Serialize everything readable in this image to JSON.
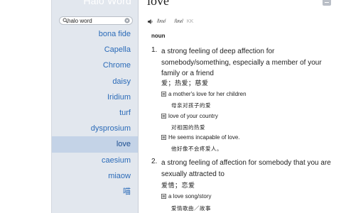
{
  "app": {
    "title": "Halo Word"
  },
  "search": {
    "value": "halo word",
    "placeholder": ""
  },
  "word_list": [
    {
      "label": "bona fide"
    },
    {
      "label": "Capella"
    },
    {
      "label": "Chrome"
    },
    {
      "label": "daisy"
    },
    {
      "label": "Iridium"
    },
    {
      "label": "turf"
    },
    {
      "label": "dysprosium"
    },
    {
      "label": "love",
      "selected": true
    },
    {
      "label": "caesium"
    },
    {
      "label": "miaow"
    },
    {
      "label": "喵"
    }
  ],
  "entry": {
    "headword": "love",
    "pron_uk": "/lʌv/",
    "pron_us": "/lʌv/",
    "pron_us_tag": "KK",
    "part_of_speech": "noun",
    "senses": [
      {
        "number": "1.",
        "definition": "a strong feeling of deep affection for somebody/something, especially a member of your family or a friend",
        "translation": "爱；热爱；慈爱",
        "examples": [
          {
            "en": "a mother's love for her children",
            "zh": "母亲对孩子的爱"
          },
          {
            "en": "love of your country",
            "zh": "对祖国的热爱"
          },
          {
            "en": "He seems incapable of love.",
            "zh": "他好像不会疼爱人。"
          }
        ]
      },
      {
        "number": "2.",
        "definition": "a strong feeling of affection for somebody that you are sexually attracted to",
        "translation": "爱情；恋爱",
        "examples": [
          {
            "en": "a love song/story",
            "zh": "爱情歌曲／故事"
          }
        ]
      }
    ]
  },
  "colors": {
    "sidebar_bg": "#e2e7ee",
    "selected_bg": "#c4d3e7",
    "link": "#2b6bb8"
  }
}
